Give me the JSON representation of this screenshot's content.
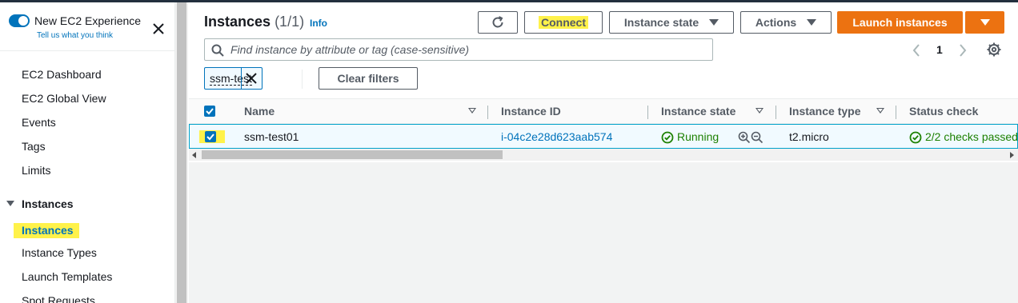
{
  "sidebar": {
    "new_experience_title": "New EC2 Experience",
    "new_experience_subtitle": "Tell us what you think",
    "items": [
      {
        "label": "EC2 Dashboard"
      },
      {
        "label": "EC2 Global View"
      },
      {
        "label": "Events"
      },
      {
        "label": "Tags"
      },
      {
        "label": "Limits"
      }
    ],
    "section_label": "Instances",
    "section_items": [
      {
        "label": "Instances",
        "active": true
      },
      {
        "label": "Instance Types"
      },
      {
        "label": "Launch Templates"
      },
      {
        "label": "Spot Requests"
      }
    ]
  },
  "header": {
    "title": "Instances",
    "count": "(1/1)",
    "info_link": "Info"
  },
  "toolbar": {
    "refresh_icon": "refresh-icon",
    "connect_label": "Connect",
    "instance_state_label": "Instance state",
    "actions_label": "Actions",
    "launch_label": "Launch instances"
  },
  "search": {
    "placeholder": "Find instance by attribute or tag (case-sensitive)",
    "value": ""
  },
  "pagination": {
    "current_page": "1"
  },
  "filter": {
    "token_label": "ssm-test",
    "clear_filters_label": "Clear filters"
  },
  "table": {
    "columns": [
      {
        "label": "Name"
      },
      {
        "label": "Instance ID"
      },
      {
        "label": "Instance state"
      },
      {
        "label": "Instance type"
      },
      {
        "label": "Status check"
      }
    ],
    "rows": [
      {
        "selected": true,
        "name": "ssm-test01",
        "instance_id": "i-04c2e28d623aab574",
        "instance_state": "Running",
        "instance_type": "t2.micro",
        "status_check": "2/2 checks passed"
      }
    ]
  },
  "colors": {
    "accent": "#0073bb",
    "launch": "#ec7211",
    "success": "#1d8102",
    "highlight": "#fff24a"
  }
}
